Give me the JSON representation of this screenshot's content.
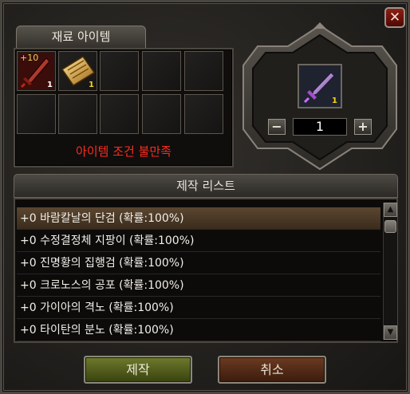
{
  "close_label": "✕",
  "materials": {
    "tab_label": "재료 아이템",
    "slots": [
      {
        "icon": "red-sword-icon",
        "plus": "+10",
        "count": "1",
        "count_color": "#ffffff"
      },
      {
        "icon": "gold-scroll-icon",
        "plus": "",
        "count": "1",
        "count_color": "#f5d31c"
      }
    ],
    "condition_message": "아이템 조건 불만족"
  },
  "result": {
    "icon": "purple-dagger-icon",
    "count": "1",
    "count_color": "#f5d31c",
    "minus_label": "−",
    "plus_label": "+",
    "quantity": "1"
  },
  "craft_list": {
    "header": "제작 리스트",
    "items": [
      "+0 바람칼날의 단검 (확률:100%)",
      "+0 수정결정체 지팡이 (확률:100%)",
      "+0 진명황의 집행검 (확률:100%)",
      "+0 크로노스의 공포 (확률:100%)",
      "+0 가이아의 격노 (확률:100%)",
      "+0 타이탄의 분노 (확률:100%)"
    ],
    "selected_index": 0,
    "scroll_up": "▲",
    "scroll_down": "▼"
  },
  "buttons": {
    "craft_label": "제작",
    "cancel_label": "취소"
  },
  "colors": {
    "error_text": "#ff2b1d",
    "craft_button": "#5a6424",
    "cancel_button": "#5a2f1a",
    "selected_row": "#5a4630"
  }
}
